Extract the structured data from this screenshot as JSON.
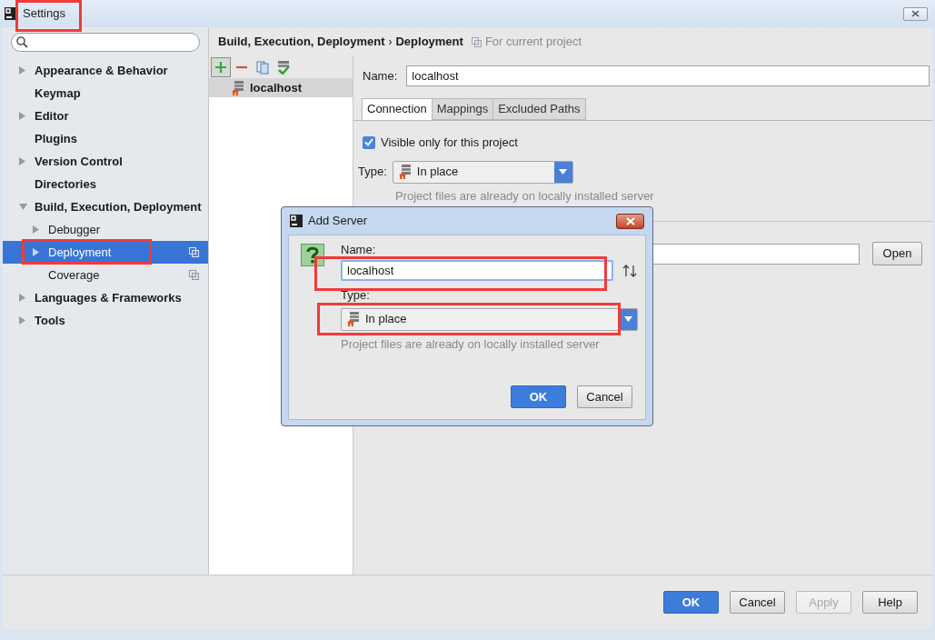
{
  "window": {
    "title": "Settings",
    "highlighted": true
  },
  "sidebar": {
    "items": [
      {
        "label": "Appearance & Behavior",
        "kind": "group",
        "expanded": false,
        "selected": false,
        "highlighted": false,
        "project_scoped": false
      },
      {
        "label": "Keymap",
        "kind": "page",
        "selected": false,
        "highlighted": false,
        "project_scoped": false
      },
      {
        "label": "Editor",
        "kind": "group",
        "expanded": false,
        "selected": false,
        "highlighted": false,
        "project_scoped": false
      },
      {
        "label": "Plugins",
        "kind": "page",
        "selected": false,
        "highlighted": false,
        "project_scoped": false
      },
      {
        "label": "Version Control",
        "kind": "group",
        "expanded": false,
        "selected": false,
        "highlighted": false,
        "project_scoped": false
      },
      {
        "label": "Directories",
        "kind": "page",
        "selected": false,
        "highlighted": false,
        "project_scoped": false
      },
      {
        "label": "Build, Execution, Deployment",
        "kind": "group",
        "expanded": true,
        "selected": false,
        "highlighted": false,
        "project_scoped": false,
        "children": [
          {
            "label": "Debugger",
            "kind": "group",
            "expanded": false,
            "selected": false,
            "highlighted": false,
            "project_scoped": false
          },
          {
            "label": "Deployment",
            "kind": "group",
            "expanded": false,
            "selected": true,
            "highlighted": true,
            "project_scoped": true
          },
          {
            "label": "Coverage",
            "kind": "page",
            "selected": false,
            "highlighted": false,
            "project_scoped": true
          }
        ]
      },
      {
        "label": "Languages & Frameworks",
        "kind": "group",
        "expanded": false,
        "selected": false,
        "highlighted": false,
        "project_scoped": false
      },
      {
        "label": "Tools",
        "kind": "group",
        "expanded": false,
        "selected": false,
        "highlighted": false,
        "project_scoped": false
      }
    ]
  },
  "breadcrumb": {
    "items": [
      "Build, Execution, Deployment",
      "›",
      "Deployment"
    ],
    "scope_note": "For current project"
  },
  "servers": {
    "toolbar": [
      {
        "kind": "add",
        "pressed": true
      },
      {
        "kind": "remove",
        "pressed": false
      },
      {
        "kind": "copy",
        "pressed": false
      },
      {
        "kind": "default",
        "pressed": false
      }
    ],
    "items": [
      {
        "name": "localhost",
        "selected": true
      }
    ]
  },
  "server_form": {
    "name_label": "Name:",
    "name_value": "localhost",
    "tabs": [
      {
        "label": "Connection",
        "selected": true
      },
      {
        "label": "Mappings",
        "selected": false
      },
      {
        "label": "Excluded Paths",
        "selected": false
      }
    ],
    "visible_only": {
      "label": "Visible only for this project",
      "checked": true
    },
    "type_label": "Type:",
    "type_value": "In place",
    "type_hint": "Project files are already on locally installed server",
    "open_button": "Open"
  },
  "dialog": {
    "title": "Add Server",
    "name_label": "Name:",
    "name_value": "localhost",
    "name_highlighted": true,
    "type_label": "Type:",
    "type_value": "In place",
    "type_highlighted": true,
    "type_hint": "Project files are already on locally installed server",
    "buttons": [
      {
        "label": "OK",
        "kind": "primary"
      },
      {
        "label": "Cancel",
        "kind": "normal"
      }
    ]
  },
  "footer": {
    "buttons": [
      {
        "label": "OK",
        "kind": "primary",
        "disabled": false
      },
      {
        "label": "Cancel",
        "kind": "normal",
        "disabled": false
      },
      {
        "label": "Apply",
        "kind": "normal",
        "disabled": true
      },
      {
        "label": "Help",
        "kind": "normal",
        "disabled": false
      }
    ]
  }
}
